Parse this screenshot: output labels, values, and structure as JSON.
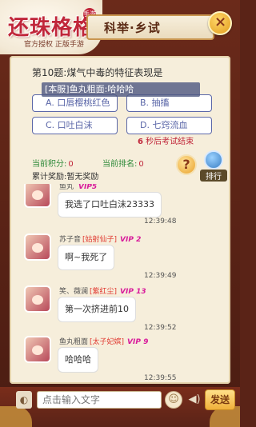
{
  "header": {
    "logo_title": "还珠格格",
    "logo_badge": "手游",
    "logo_sub": "官方授权 正版手游",
    "page_title": "科举·乡试",
    "close_icon": "×"
  },
  "question": {
    "text": "第10题:煤气中毒的特征表现是",
    "answer_tip": "[本服]鱼丸粗面:哈哈哈",
    "options": [
      {
        "label": "A. 口唇樱桃红色"
      },
      {
        "label": "B. 抽搐"
      },
      {
        "label": "C. 口吐白沫"
      },
      {
        "label": "D. 七窍流血"
      }
    ],
    "countdown_num": "6",
    "countdown_text": " 秒后考试结束"
  },
  "stats": {
    "score_label": "当前积分:",
    "score_value": "0",
    "rank_label": "当前排名:",
    "rank_value": "0",
    "reward_label": "累计奖励:",
    "reward_value": "暂无奖励",
    "help_icon": "?",
    "rank_button": "排行"
  },
  "chat": [
    {
      "name": "鱼丸",
      "title": "",
      "vip": "VIP5",
      "text": "我选了口吐白沫23333",
      "time": "12:39:48"
    },
    {
      "name": "苏子音",
      "title": "[姑射仙子]",
      "vip": "VIP 2",
      "text": "啊~我死了",
      "time": "12:39:49"
    },
    {
      "name": "笑、薇澜",
      "title": "[紫红尘]",
      "vip": "VIP 13",
      "text": "第一次挤进前10",
      "time": "12:39:52"
    },
    {
      "name": "鱼丸粗面",
      "title": "[太子妃嫔]",
      "vip": "VIP 9",
      "text": "哈哈哈",
      "time": "12:39:55"
    }
  ],
  "input": {
    "placeholder": "点击输入文字",
    "send_label": "发送",
    "voice_icon": "◐",
    "emoji_icon": "☺",
    "speaker_icon": "◀)"
  },
  "colors": {
    "accent_red": "#c0263a",
    "option_blue": "#5b67a8",
    "vip_pink": "#d81b9b",
    "panel_bg": "#f6eedb"
  }
}
